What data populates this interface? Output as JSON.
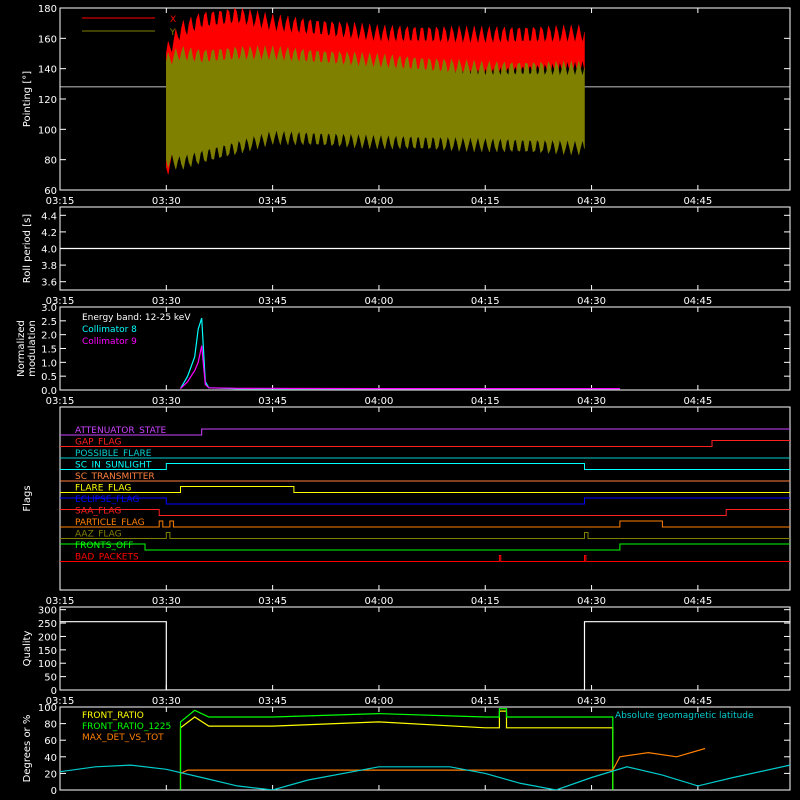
{
  "chart_data": [
    {
      "type": "area",
      "id": "pointing",
      "ylabel": "Pointing [°]",
      "ylim": [
        60,
        180
      ],
      "yticks": [
        60,
        80,
        100,
        120,
        140,
        160,
        180
      ],
      "xticks": [
        "03:15",
        "03:30",
        "03:45",
        "04:00",
        "04:15",
        "04:30",
        "04:45"
      ],
      "legend": [
        "X",
        "Y"
      ],
      "reference_y": 128,
      "series": [
        {
          "name": "X",
          "color": "#ff0000",
          "x": [
            "03:30",
            "03:32",
            "03:35",
            "03:40",
            "03:45",
            "04:00",
            "04:15",
            "04:29"
          ],
          "high": [
            150,
            165,
            172,
            175,
            170,
            163,
            162,
            163
          ],
          "low": [
            75,
            85,
            100,
            110,
            115,
            128,
            135,
            140
          ]
        },
        {
          "name": "Y",
          "color": "#808000",
          "x": [
            "03:30",
            "03:32",
            "03:35",
            "03:40",
            "03:45",
            "04:00",
            "04:15",
            "04:29"
          ],
          "high": [
            145,
            150,
            148,
            150,
            150,
            145,
            140,
            140
          ],
          "low": [
            80,
            78,
            82,
            88,
            95,
            92,
            90,
            88
          ]
        }
      ]
    },
    {
      "type": "line",
      "id": "roll",
      "ylabel": "Roll period [s]",
      "ylim": [
        3.5,
        4.5
      ],
      "yticks": [
        3.6,
        3.8,
        4.0,
        4.2,
        4.4
      ],
      "xticks": [
        "03:15",
        "03:30",
        "03:45",
        "04:00",
        "04:15",
        "04:30",
        "04:45"
      ],
      "series": [
        {
          "name": "",
          "x": [
            "03:15",
            "04:58"
          ],
          "y": [
            4.0,
            4.0
          ],
          "color": "#ffffff"
        }
      ]
    },
    {
      "type": "line",
      "id": "modulation",
      "ylabel": "Normalized modulation",
      "ylim": [
        0,
        3.0
      ],
      "yticks": [
        0.0,
        0.5,
        1.0,
        1.5,
        2.0,
        2.5,
        3.0
      ],
      "xticks": [
        "03:15",
        "03:30",
        "03:45",
        "04:00",
        "04:15",
        "04:30",
        "04:45"
      ],
      "annotation": "Energy band: 12-25 keV",
      "series": [
        {
          "name": "Collimator 8",
          "color": "#00ffff",
          "x": [
            "03:32",
            "03:33",
            "03:34",
            "03:34.5",
            "03:35",
            "03:35.5",
            "03:36",
            "03:40",
            "04:00",
            "04:20",
            "04:34"
          ],
          "y": [
            0.05,
            0.5,
            1.2,
            2.2,
            2.6,
            0.3,
            0.08,
            0.05,
            0.05,
            0.05,
            0.05
          ]
        },
        {
          "name": "Collimator 9",
          "color": "#ff00ff",
          "x": [
            "03:32",
            "03:33",
            "03:34",
            "03:34.5",
            "03:35",
            "03:35.5",
            "03:36",
            "03:40",
            "04:00",
            "04:20",
            "04:34"
          ],
          "y": [
            0.05,
            0.3,
            0.7,
            1.0,
            1.6,
            0.2,
            0.08,
            0.06,
            0.05,
            0.05,
            0.05
          ]
        }
      ]
    },
    {
      "type": "line",
      "id": "flags",
      "ylabel": "Flags",
      "xticks": [
        "03:15",
        "03:30",
        "03:45",
        "04:00",
        "04:15",
        "04:30",
        "04:45"
      ],
      "series": [
        {
          "name": "ATTENUATOR_STATE",
          "color": "#cc44ff",
          "x": [
            "03:15",
            "03:35",
            "03:35",
            "04:58"
          ],
          "y": [
            0,
            0,
            1,
            1
          ]
        },
        {
          "name": "GAP_FLAG",
          "color": "#ff2020",
          "x": [
            "03:15",
            "04:47",
            "04:47",
            "04:58"
          ],
          "y": [
            0,
            0,
            1,
            1
          ]
        },
        {
          "name": "POSSIBLE_FLARE",
          "color": "#00cccc",
          "x": [
            "03:15",
            "04:58"
          ],
          "y": [
            0,
            0
          ]
        },
        {
          "name": "SC_IN_SUNLIGHT",
          "color": "#00ffff",
          "x": [
            "03:15",
            "03:30",
            "03:30",
            "04:29",
            "04:29",
            "04:58"
          ],
          "y": [
            0,
            0,
            1,
            1,
            0,
            0
          ]
        },
        {
          "name": "SC_TRANSMITTER",
          "color": "#ff8040",
          "x": [
            "03:15",
            "04:58"
          ],
          "y": [
            0,
            0
          ]
        },
        {
          "name": "FLARE_FLAG",
          "color": "#ffff00",
          "x": [
            "03:15",
            "03:32",
            "03:32",
            "03:48",
            "03:48",
            "04:58"
          ],
          "y": [
            0,
            0,
            1,
            1,
            0,
            0
          ]
        },
        {
          "name": "ECLIPSE_FLAG",
          "color": "#0000ff",
          "x": [
            "03:15",
            "03:30",
            "03:30",
            "04:29",
            "04:29",
            "04:58"
          ],
          "y": [
            1,
            1,
            0,
            0,
            1,
            1
          ]
        },
        {
          "name": "SAA_FLAG",
          "color": "#ff2020",
          "x": [
            "03:15",
            "03:29",
            "03:29",
            "04:49",
            "04:49",
            "04:58"
          ],
          "y": [
            1,
            1,
            0,
            0,
            1,
            1
          ]
        },
        {
          "name": "PARTICLE_FLAG",
          "color": "#ff8000",
          "x": [
            "03:15",
            "03:29",
            "03:29",
            "03:29.5",
            "03:29.5",
            "03:30.5",
            "03:30.5",
            "03:31",
            "03:31",
            "04:34",
            "04:34",
            "04:40",
            "04:40",
            "04:58"
          ],
          "y": [
            0,
            0,
            1,
            1,
            0,
            0,
            1,
            1,
            0,
            0,
            1,
            1,
            0,
            0
          ]
        },
        {
          "name": "AAZ_FLAG",
          "color": "#808000",
          "x": [
            "03:15",
            "03:30",
            "03:30",
            "03:30.5",
            "03:30.5",
            "04:29",
            "04:29",
            "04:29.5",
            "04:29.5",
            "04:58"
          ],
          "y": [
            0,
            0,
            1,
            1,
            0,
            0,
            1,
            1,
            0,
            0
          ]
        },
        {
          "name": "FRONTS_OFF",
          "color": "#00ff00",
          "x": [
            "03:15",
            "03:27",
            "03:27",
            "04:34",
            "04:34",
            "04:58"
          ],
          "y": [
            1,
            1,
            0,
            0,
            1,
            1
          ]
        },
        {
          "name": "BAD_PACKETS",
          "color": "#ff0000",
          "x": [
            "03:15",
            "04:17",
            "04:17",
            "04:17.2",
            "04:17.2",
            "04:29",
            "04:29",
            "04:29.2",
            "04:29.2",
            "04:58"
          ],
          "y": [
            0,
            0,
            1,
            1,
            0,
            0,
            1,
            1,
            0,
            0
          ]
        }
      ]
    },
    {
      "type": "line",
      "id": "quality",
      "ylabel": "Quality",
      "ylim": [
        0,
        310
      ],
      "yticks": [
        0,
        50,
        100,
        150,
        200,
        250,
        300
      ],
      "xticks": [
        "03:15",
        "03:30",
        "03:45",
        "04:00",
        "04:15",
        "04:30",
        "04:45"
      ],
      "series": [
        {
          "name": "",
          "color": "#ffffff",
          "x": [
            "03:15",
            "03:30",
            "03:30",
            "04:29",
            "04:29",
            "04:58"
          ],
          "y": [
            255,
            255,
            0,
            0,
            255,
            255
          ]
        }
      ]
    },
    {
      "type": "line",
      "id": "ratios",
      "ylabel": "Degrees or %",
      "ylim": [
        0,
        100
      ],
      "yticks": [
        0,
        20,
        40,
        60,
        80,
        100
      ],
      "xticks": [
        "03:15",
        "03:30",
        "03:45",
        "04:00",
        "04:15",
        "04:30",
        "04:45"
      ],
      "series": [
        {
          "name": "FRONT_RATIO",
          "color": "#ffff00",
          "x": [
            "03:32",
            "03:32",
            "03:34",
            "03:36",
            "03:45",
            "04:00",
            "04:15",
            "04:17",
            "04:17",
            "04:18",
            "04:18",
            "04:33",
            "04:33"
          ],
          "y": [
            0,
            75,
            88,
            77,
            77,
            82,
            75,
            75,
            95,
            95,
            75,
            75,
            0
          ]
        },
        {
          "name": "FRONT_RATIO_1225",
          "color": "#00ff00",
          "x": [
            "03:32",
            "03:32",
            "03:34",
            "03:36",
            "03:45",
            "04:00",
            "04:15",
            "04:17",
            "04:17",
            "04:18",
            "04:18",
            "04:33",
            "04:33"
          ],
          "y": [
            0,
            82,
            96,
            88,
            88,
            92,
            88,
            88,
            98,
            98,
            88,
            88,
            0
          ]
        },
        {
          "name": "MAX_DET_VS_TOT",
          "color": "#ff8000",
          "x": [
            "03:32",
            "03:33",
            "03:45",
            "04:00",
            "04:15",
            "04:33",
            "04:34",
            "04:38",
            "04:42",
            "04:46"
          ],
          "y": [
            20,
            24,
            24,
            24,
            24,
            24,
            40,
            45,
            40,
            50
          ]
        },
        {
          "name": "Absolute geomagnetic latitude",
          "color": "#00cccc",
          "x": [
            "03:15",
            "03:20",
            "03:25",
            "03:30",
            "03:35",
            "03:40",
            "03:45",
            "03:50",
            "04:00",
            "04:10",
            "04:15",
            "04:20",
            "04:25",
            "04:30",
            "04:35",
            "04:40",
            "04:45",
            "04:50",
            "04:58"
          ],
          "y": [
            22,
            28,
            30,
            25,
            15,
            5,
            0,
            12,
            28,
            28,
            20,
            8,
            0,
            15,
            28,
            18,
            5,
            15,
            30
          ]
        }
      ]
    }
  ]
}
